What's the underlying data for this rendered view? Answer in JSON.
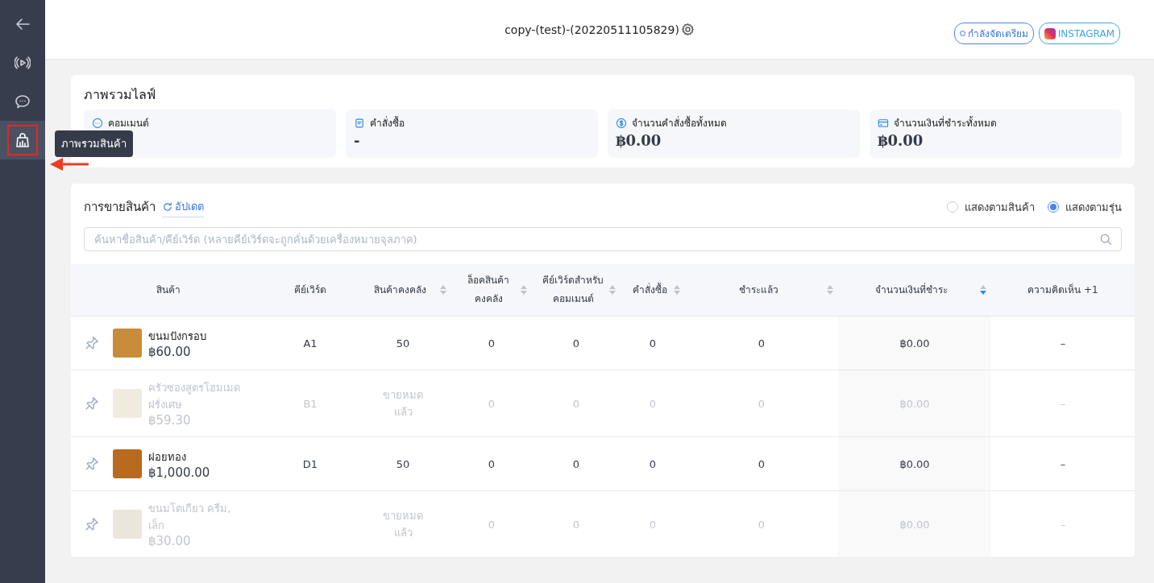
{
  "sidebar": {
    "items": [
      {
        "kind": "back",
        "selected": false,
        "highlighted": false
      },
      {
        "kind": "live",
        "selected": false,
        "highlighted": false
      },
      {
        "kind": "comment",
        "selected": false,
        "highlighted": false
      },
      {
        "kind": "products",
        "selected": true,
        "highlighted": true
      }
    ],
    "tooltip": "ภาพรวมสินค้า"
  },
  "header": {
    "title": "copy-(test)-(20220511105829)",
    "status": "กำลังจัดเตรียม",
    "platform": "INSTAGRAM"
  },
  "overview": {
    "title": "ภาพรวมไลฟ์",
    "stats": [
      {
        "kind": "comment",
        "label": "คอมเมนต์"
      },
      {
        "kind": "orders",
        "label": "คำสั่งซื้อ",
        "value": "-"
      },
      {
        "kind": "money",
        "label": "จำนวนคำสั่งซื้อทั้งหมด",
        "value": "฿0.00"
      },
      {
        "kind": "card",
        "label": "จำนวนเงินที่ชำระทั้งหมด",
        "value": "฿0.00"
      }
    ]
  },
  "sales": {
    "title": "การขายสินค้า",
    "refresh": "อัปเดต",
    "view_options": [
      {
        "label": "แสดงตามสินค้า",
        "selected": false
      },
      {
        "label": "แสดงตามรุ่น",
        "selected": true
      }
    ],
    "search": {
      "placeholder": "ค้นหาชื่อสินค้า/คีย์เวิร์ด (หลายคีย์เวิร์ดจะถูกคั่นด้วยเครื่องหมายจุลภาค)"
    },
    "table": {
      "columns": [
        {
          "label": "สินค้า"
        },
        {
          "label": "คีย์เวิร์ด"
        },
        {
          "label": "สินค้าคงคลัง",
          "sortable": true,
          "sorted_desc": false
        },
        {
          "label": "ล็อคสินค้า คงคลัง",
          "sortable": true,
          "sorted_desc": false
        },
        {
          "label": "คีย์เวิร์ดสำหรับ คอมเมนต์",
          "sortable": true,
          "sorted_desc": false
        },
        {
          "label": "คำสั่งซื้อ",
          "sortable": true,
          "sorted_desc": false
        },
        {
          "label": "ชำระแล้ว",
          "sortable": true,
          "sorted_desc": false
        },
        {
          "label": "จำนวนเงินที่ชำระ",
          "sortable": true,
          "sorted_desc": true
        },
        {
          "label": "ความคิดเห็น +1"
        }
      ],
      "rows": [
        {
          "pinned": false,
          "disabled": false,
          "cells": [
            {
              "name": "ขนมปังกรอบ",
              "price": "฿60.00"
            },
            "A1",
            "50",
            "0",
            "0",
            "0",
            "0",
            "฿0.00",
            "–"
          ]
        },
        {
          "pinned": false,
          "disabled": true,
          "cells": [
            {
              "name": "ครัวซองสูตรโฮมเมด ฝรั่งเศษ",
              "price": "฿59.30"
            },
            "B1",
            "ขายหมด แล้ว",
            "0",
            "0",
            "0",
            "0",
            "฿0.00",
            "–"
          ]
        },
        {
          "pinned": false,
          "disabled": false,
          "cells": [
            {
              "name": "ฝอยทอง",
              "price": "฿1,000.00"
            },
            "D1",
            "50",
            "0",
            "0",
            "0",
            "0",
            "฿0.00",
            "–"
          ]
        },
        {
          "pinned": false,
          "disabled": true,
          "cells": [
            {
              "name": "ขนมโตเกียว ครีม, เล็ก",
              "price": "฿30.00"
            },
            null,
            "ขายหมด แล้ว",
            "0",
            "0",
            "0",
            "0",
            "฿0.00",
            "–"
          ]
        }
      ]
    }
  }
}
